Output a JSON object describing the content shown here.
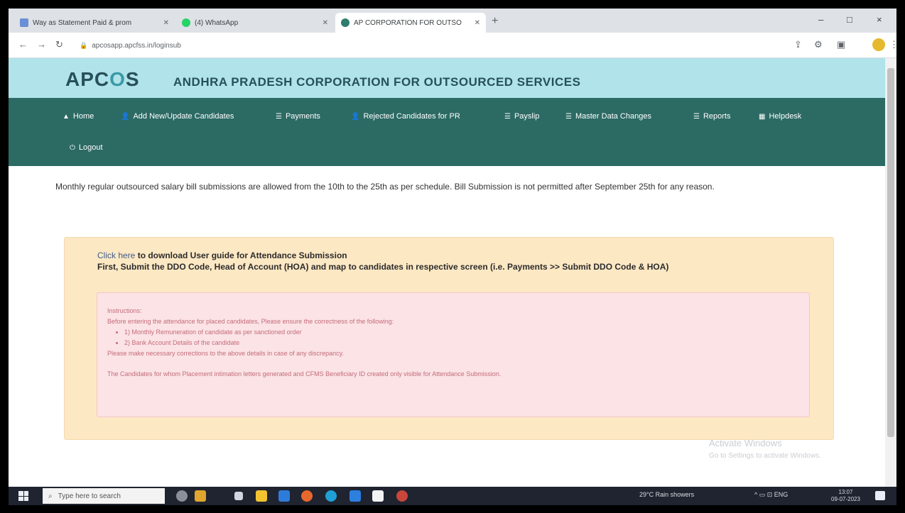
{
  "browser": {
    "tabs": [
      {
        "title": "Way as Statement Paid & prom",
        "color": "#6a8fd6"
      },
      {
        "title": "(4) WhatsApp",
        "color": "#25d366"
      },
      {
        "title": "AP CORPORATION FOR OUTSO",
        "color": "#2e7d6f"
      }
    ],
    "new_tab": "+",
    "window_controls": {
      "minimize": "–",
      "maximize": "□",
      "close": "×"
    },
    "nav": {
      "back": "←",
      "forward": "→",
      "reload": "↻"
    },
    "url": "apcosapp.apcfss.in/loginsub",
    "lock": "🔒"
  },
  "header": {
    "logo_text": "APC",
    "logo_o": "O",
    "logo_s": "S",
    "org_name": "ANDHRA PRADESH CORPORATION FOR OUTSOURCED SERVICES"
  },
  "nav": {
    "items": [
      {
        "label": "Home",
        "icon": "home-icon",
        "glyph": "▲"
      },
      {
        "label": "Add New/Update Candidates",
        "icon": "user-add-icon",
        "glyph": "👤"
      },
      {
        "label": "Payments",
        "icon": "list-icon",
        "glyph": "☰"
      },
      {
        "label": "Rejected Candidates for PR",
        "icon": "user-icon",
        "glyph": "👤"
      },
      {
        "label": "Payslip",
        "icon": "list-icon",
        "glyph": "☰"
      },
      {
        "label": "Master Data Changes",
        "icon": "list-icon",
        "glyph": "☰"
      },
      {
        "label": "Reports",
        "icon": "list-icon",
        "glyph": "☰"
      },
      {
        "label": "Helpdesk",
        "icon": "helpdesk-icon",
        "glyph": "▦"
      },
      {
        "label": "Logout",
        "icon": "power-icon",
        "glyph": "⏻"
      }
    ]
  },
  "main": {
    "notice": "Monthly regular outsourced salary bill submissions are allowed from the 10th to the 25th as per schedule. Bill Submission is not permitted after September 25th for any reason.",
    "guide_link": "Click here",
    "guide_text": " to download User guide for Attendance Submission",
    "guide_step": "First, Submit the DDO Code, Head of Account (HOA) and map to candidates in respective screen (i.e. Payments >> Submit DDO Code & HOA)",
    "instructions": {
      "heading": "Instructions:",
      "intro": "Before entering the attendance for placed candidates, Please ensure the correctness of the following:",
      "points": [
        "1) Monthly Remuneration of candidate as per sanctioned order",
        "2) Bank Account Details of the candidate"
      ],
      "note": "Please make necessary corrections to the above details in case of any discrepancy.",
      "footer": "The Candidates for whom Placement intimation letters generated and CFMS Beneficiary ID created only visible for Attendance Submission."
    },
    "watermark": {
      "title": "Activate Windows",
      "subtitle": "Go to Settings to activate Windows."
    }
  },
  "taskbar": {
    "search_placeholder": "Type here to search",
    "weather": "29°C  Rain showers",
    "tray_icons": "^ ▭ ⊡ ENG",
    "time": "13:07",
    "date": "09-07-2023"
  },
  "colors": {
    "brand_bar": "#b0e3ea",
    "nav_bar": "#2c6a64",
    "panel": "#fde8c4",
    "instructions": "#fbe3e6"
  }
}
